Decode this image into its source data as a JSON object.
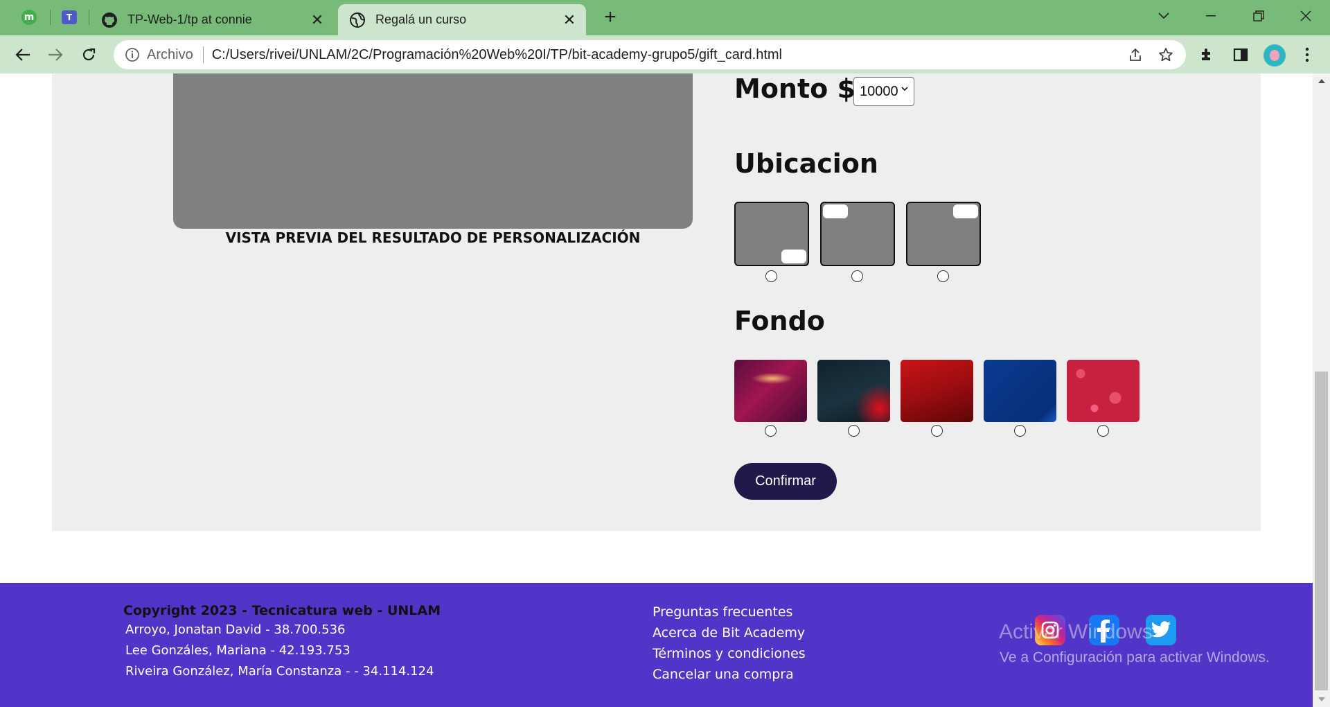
{
  "browser": {
    "tabs": [
      {
        "title": "TP-Web-1/tp at connie",
        "icon": "github-icon"
      },
      {
        "title": "Regalá un curso",
        "icon": "globe-icon",
        "active": true
      }
    ],
    "pinned": [
      {
        "icon": "m-app-icon",
        "letter": "m"
      },
      {
        "icon": "teams-icon",
        "letter": "T"
      }
    ],
    "address": {
      "label": "Archivo",
      "url": "C:/Users/rivei/UNLAM/2C/Programación%20Web%20I/TP/bit-academy-grupo5/gift_card.html"
    }
  },
  "page": {
    "preview_caption": "VISTA PREVIA DEL RESULTADO DE PERSONALIZACIÓN",
    "monto": {
      "title": "Monto $",
      "selected": "10000"
    },
    "ubicacion": {
      "title": "Ubicacion",
      "options": [
        "bottom-right",
        "top-left",
        "top-right"
      ]
    },
    "fondo": {
      "title": "Fondo",
      "options": [
        "purple-abstract",
        "dark-network",
        "red-polygon",
        "solid-blue",
        "pink-hearts"
      ]
    },
    "confirm_label": "Confirmar"
  },
  "footer": {
    "copyright": "Copyright 2023 - Tecnicatura web - UNLAM",
    "members": [
      "Arroyo, Jonatan David - 38.700.536",
      "Lee Gonzáles, Mariana - 42.193.753",
      "Riveira González, María Constanza - - 34.114.124"
    ],
    "links": [
      "Preguntas frecuentes",
      "Acerca de Bit Academy",
      "Términos y condiciones",
      "Cancelar una compra"
    ],
    "social": [
      "instagram-icon",
      "facebook-icon",
      "twitter-icon"
    ]
  },
  "watermark": {
    "line1": "Activar Windows",
    "line2": "Ve a Configuración para activar Windows."
  },
  "colors": {
    "tabbar": "#78ba78",
    "toolbar": "#cce5cc",
    "footer": "#5234c8",
    "button": "#1f1a4a",
    "section": "#eeeeee"
  }
}
